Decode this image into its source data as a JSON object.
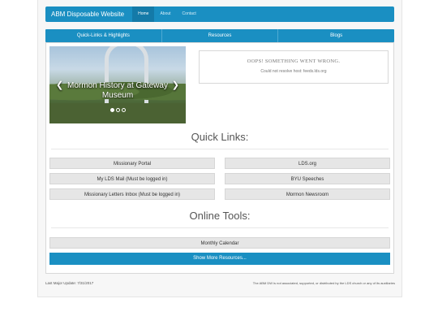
{
  "navbar": {
    "brand": "ABM Disposable Website",
    "links": [
      "Home",
      "About",
      "Contact"
    ]
  },
  "tabs": [
    "Quick-Links & Highlights",
    "Resources",
    "Blogs"
  ],
  "carousel": {
    "caption": "Mormon History at Gateway Museum",
    "slide_count": 3,
    "active_slide": 1
  },
  "feed_error": {
    "title": "OOPS! SOMETHING WENT WRONG.",
    "message": "Could not resolve host: feeds.lds.org"
  },
  "quick_links": {
    "title": "Quick Links:",
    "left": [
      "Missionary Portal",
      "My LDS Mail (Must be logged in)",
      "Missionary Letters Inbox (Must be logged in)"
    ],
    "right": [
      "LDS.org",
      "BYU Speeches",
      "Mormon Newsroom"
    ]
  },
  "online_tools": {
    "title": "Online Tools:",
    "calendar": "Monthly Calendar",
    "show_more": "Show More Resources..."
  },
  "footer": {
    "left": "Last Major Update: 7/31/2017",
    "right": "The ABM DW is not associated, supported, or distributed by the LDS church or any of its auxiliaries"
  },
  "colors": {
    "primary": "#1a8fc2",
    "button": "#e6e6e6"
  }
}
